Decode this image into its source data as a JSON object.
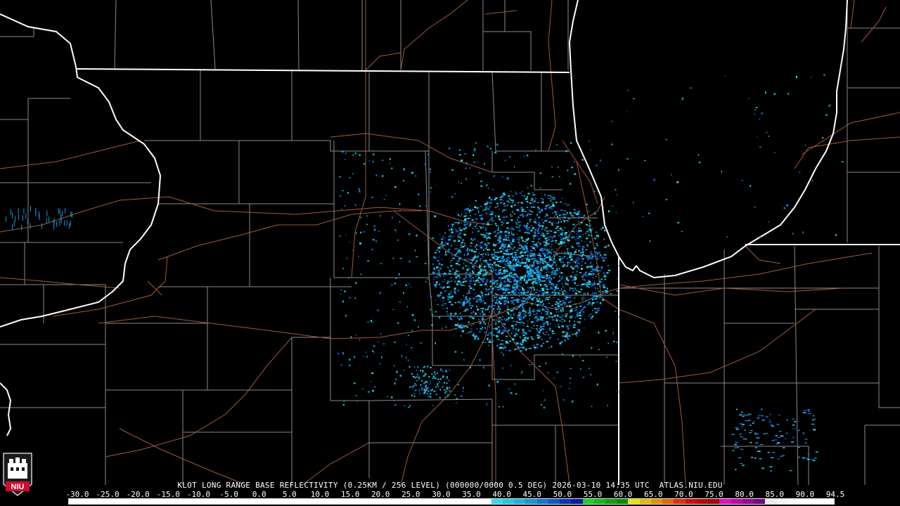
{
  "product": {
    "caption": "KLOT LONG RANGE BASE REFLECTIVITY (0.25KM / 256 LEVEL) (000000/0000 0.5 DEG) 2026-03-10 14:35 UTC  ATLAS.NIU.EDU"
  },
  "legend": {
    "ticks": [
      "-30.0",
      "-25.0",
      "-20.0",
      "-15.0",
      "-10.0",
      "-5.0",
      "0.0",
      "5.0",
      "10.0",
      "15.0",
      "20.0",
      "25.0",
      "30.0",
      "35.0",
      "40.0",
      "45.0",
      "50.0",
      "55.0",
      "60.0",
      "65.0",
      "70.0",
      "75.0",
      "80.0",
      "85.0",
      "90.0",
      "94.5"
    ],
    "colors": [
      "#ffffff",
      "#ffffff",
      "#ffffff",
      "#ffffff",
      "#ffffff",
      "#ffffff",
      "#ffffff",
      "#ffffff",
      "#ffffff",
      "#ffffff",
      "#ffffff",
      "#ffffff",
      "#ffffff",
      "#ffffff",
      "#ffffff",
      "#ffffff",
      "#ffffff",
      "#ffffff",
      "#ffffff",
      "#ffffff",
      "#ffffff",
      "#ffffff",
      "#ffffff",
      "#ffffff",
      "#ffffff",
      "#ffffff",
      "#ffffff",
      "#ffffff",
      "#ffffff",
      "#ffffff",
      "#ffffff",
      "#ffffff",
      "#ffffff",
      "#ffffff",
      "#ffffff",
      "#ffffff",
      "#ffffff",
      "#3ad8e8",
      "#2ac7e0",
      "#1eb2dc",
      "#1a96d6",
      "#1578d0",
      "#1258c8",
      "#0d34b8",
      "#0a1aa0",
      "#1ad020",
      "#14b818",
      "#0e9e10",
      "#088a08",
      "#e8e010",
      "#e0b808",
      "#e09008",
      "#e06808",
      "#e03010",
      "#d01010",
      "#b80a0a",
      "#a00808",
      "#e010c0",
      "#c008a8",
      "#9a0898",
      "#7a0880",
      "#f0e8f0",
      "#f4f4f4",
      "#f8f8f8",
      "#ffffff",
      "#ffffff",
      "#ffffff"
    ]
  },
  "logo": {
    "text": "NIU"
  }
}
